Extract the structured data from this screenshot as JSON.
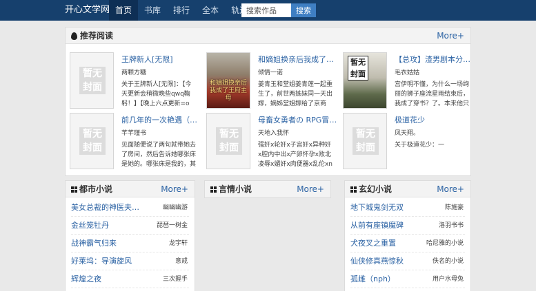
{
  "header": {
    "brand": "开心文学网",
    "nav": [
      "首页",
      "书库",
      "排行",
      "全本",
      "轨迹"
    ],
    "search_placeholder": "搜索作品",
    "search_button": "搜索"
  },
  "recommend": {
    "title": "推荐阅读",
    "more": "More+",
    "items": [
      {
        "title": "王牌新人[无限]",
        "author": "两颗方糖",
        "desc": "关于王牌新人[无限]：【今天更新会稍微晚些qwq鞠躬！】【晚上六点更新=o=】主神空"
      },
      {
        "title": "和嫡姐换亲后我成了…",
        "author": "倾情一诺",
        "desc": "姜青玉和堂姐姜青莲一起重生了，前世两姊妹同一天出嫁，嫡姊堂姐嫁给了京商"
      },
      {
        "title": "【总攻】渣男剧本分…",
        "author": "毛衣姑姑",
        "desc": "宫伊明不懂，为什么一场绚丽的狮子座流星雨结束后，我成了穿书？了。本来他只是"
      },
      {
        "title": "前几年的一次艳遇（…",
        "author": "芊芊瑾书",
        "desc": "见面随便说了两句就带她去了房间，然后告诉她哪张床是她的。哪张床是我的，其实当"
      },
      {
        "title": "母畜女勇者の RPG冒…",
        "author": "天地入我怀",
        "desc": "强奸x轮奸x子宫奸x异种奸x腔内中出x产卵怀孕x败北凌辱x媚奸x肉便器x乱伦xntr 少女勇"
      },
      {
        "title": "极道花少",
        "author": "凤天翔。",
        "desc": "关于极道花少：一"
      }
    ],
    "cover_placeholder": [
      "暂无",
      "封面"
    ],
    "cover1_text": "和嫡姐换亲后我成了王府主母"
  },
  "lists": [
    {
      "title": "都市小说",
      "more": "More+",
      "rows": [
        {
          "title": "美女总裁的神医夫…",
          "author": "幽幽幽游"
        },
        {
          "title": "金丝笼牡丹",
          "author": "琵琶一树金"
        },
        {
          "title": "战神霸气归来",
          "author": "龙宇轩"
        },
        {
          "title": "好莱坞：导演旋风",
          "author": "意戒"
        },
        {
          "title": "辉煌之夜",
          "author": "三次握手"
        }
      ]
    },
    {
      "title": "言情小说",
      "more": "More+",
      "rows": []
    },
    {
      "title": "玄幻小说",
      "more": "More+",
      "rows": [
        {
          "title": "地下城鬼剑无双",
          "author": "陈施豪"
        },
        {
          "title": "从前有座镇魔碑",
          "author": "洛羽书书"
        },
        {
          "title": "犬夜叉之重置",
          "author": "哈尼雅的小说"
        },
        {
          "title": "仙侠修真燕惊秋",
          "author": "佚名的小说"
        },
        {
          "title": "孤雌（nph）",
          "author": "用户水母兔"
        }
      ]
    }
  ]
}
